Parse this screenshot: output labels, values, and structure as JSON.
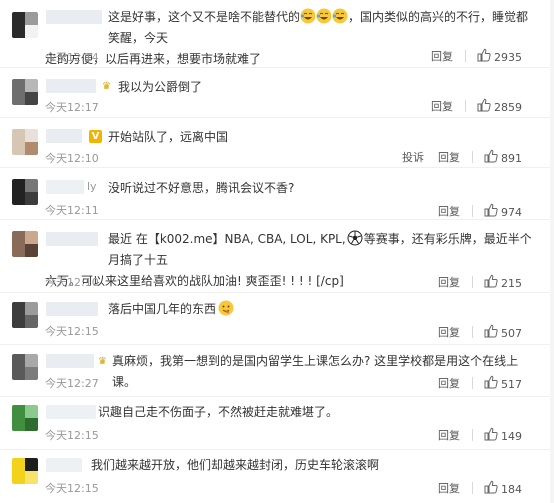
{
  "actions": {
    "report_label": "投诉",
    "reply_label": "回复"
  },
  "comments": [
    {
      "text_1": "这是好事，这个又不是啥不能替代的",
      "text_2": "，国内类似的高兴的不行，睡觉都笑醒，今天",
      "text_3": "走的方便，以后再进来，想要市场就难了",
      "time": "今天12:14",
      "likes": "2935"
    },
    {
      "text": "我以为公爵倒了",
      "time": "今天12:17",
      "likes": "2859"
    },
    {
      "text": "开始站队了，远离中国",
      "time": "今天12:10",
      "likes": "891"
    },
    {
      "nick_tail": "ly",
      "text": "没听说过不好意思，腾讯会议不香?",
      "time": "今天12:11",
      "likes": "974"
    },
    {
      "text_1": "最近 在【k002.me】NBA, CBA, LOL, KPL,",
      "text_2": "等赛事，还有彩乐牌，最近半个月搞了十五",
      "text_3": "六万。可以来这里给喜欢的战队加油! 爽歪歪! ! ! ! [/cp]",
      "time": "今天12:10",
      "likes": "215"
    },
    {
      "text": "落后中国几年的东西",
      "time": "今天12:15",
      "likes": "507"
    },
    {
      "text": "真麻烦，我第一想到的是国内留学生上课怎么办? 这里学校都是用这个在线上课。",
      "time": "今天12:27",
      "likes": "517"
    },
    {
      "text": "识趣自己走不伤面子，不然被赶走就难堪了。",
      "time": "今天12:15",
      "likes": "149"
    },
    {
      "text": "我们越来越开放，他们却越来越封闭，历史车轮滚滚啊",
      "time": "今天12:15",
      "likes": "184"
    }
  ],
  "colors": {
    "text": "#333333",
    "meta": "#999999",
    "divider": "#f0f0f0",
    "nick_mask": "#e9edf1",
    "vip_gold": "#f3b400"
  },
  "icons": {
    "like": "thumbs-up-icon",
    "crown": "crown-icon",
    "verified": "v-badge-icon",
    "emoji_laugh": "laughing-emoji-icon",
    "emoji_soccer": "soccer-ball-icon",
    "emoji_yum": "yum-emoji-icon"
  }
}
